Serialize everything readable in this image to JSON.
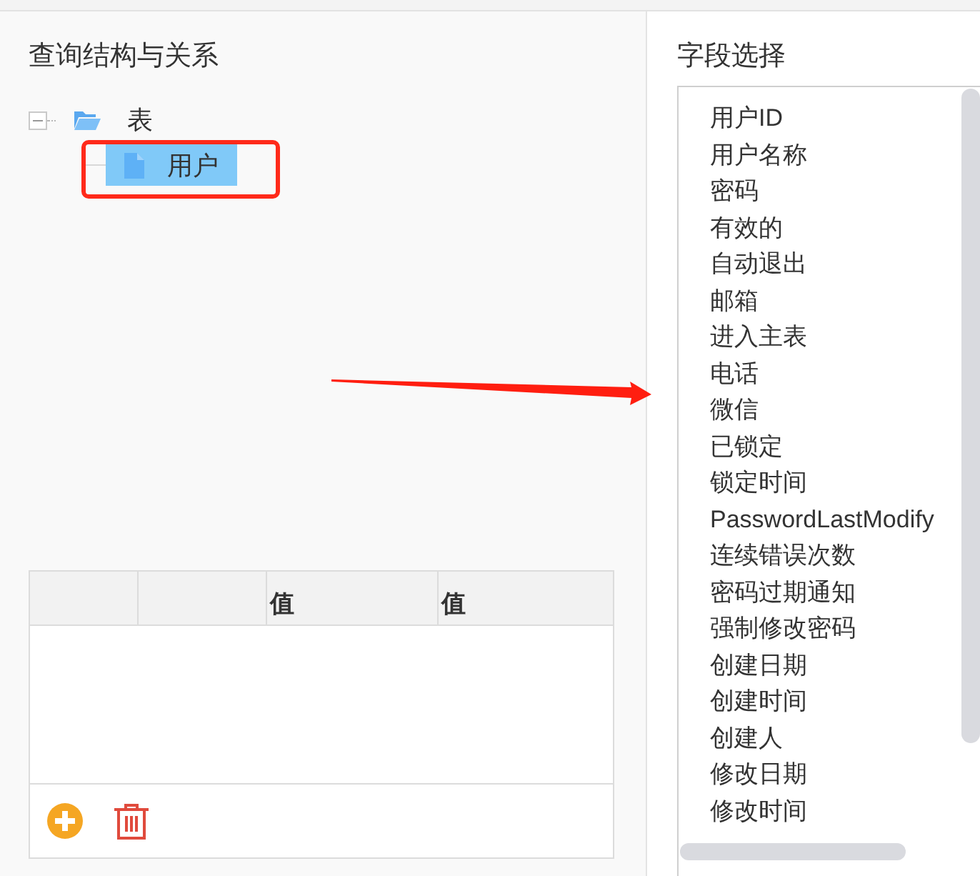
{
  "left_panel": {
    "title": "查询结构与关系",
    "tree": [
      {
        "label": "表",
        "kind": "folder",
        "expanded": true,
        "selected": false,
        "framed": false,
        "children": [
          {
            "label": "用户",
            "kind": "file",
            "selected": true,
            "framed": true
          }
        ]
      }
    ],
    "table": {
      "columns": [
        {
          "kind": "blank"
        },
        {
          "kind": "blank"
        },
        {
          "kind": "text",
          "header": "值"
        },
        {
          "kind": "text",
          "header": "值"
        }
      ]
    },
    "toolbar": [
      {
        "kind": "add"
      },
      {
        "kind": "delete"
      }
    ]
  },
  "right_panel": {
    "title": "字段选择",
    "fields": [
      "用户ID",
      "用户名称",
      "密码",
      "有效的",
      "自动退出",
      "邮箱",
      "进入主表",
      "电话",
      "微信",
      "已锁定",
      "锁定时间",
      "PasswordLastModify",
      "连续错误次数",
      "密码过期通知",
      "强制修改密码",
      "创建日期",
      "创建时间",
      "创建人",
      "修改日期",
      "修改时间"
    ]
  },
  "annotations": [
    {
      "kind": "arrow"
    }
  ]
}
